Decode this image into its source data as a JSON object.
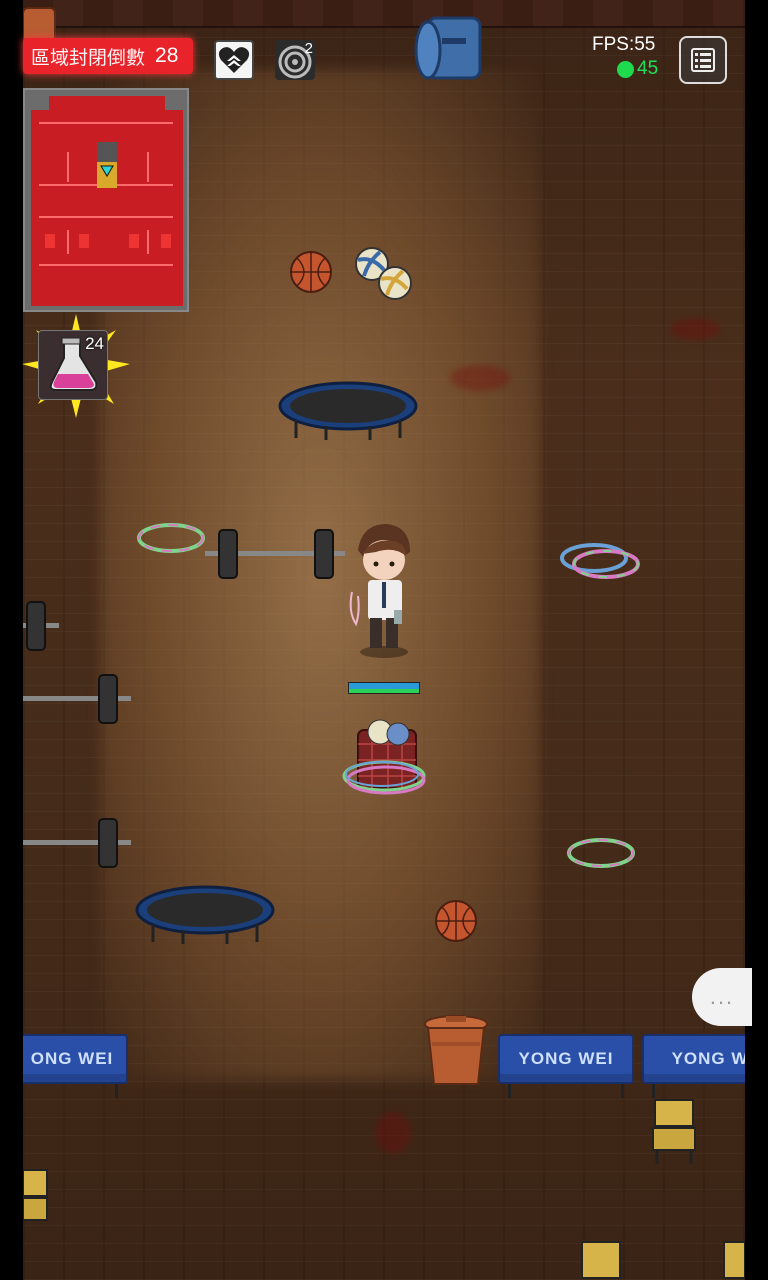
{
  "hud": {
    "countdown_label": "區域封閉倒數",
    "countdown_value": "28",
    "target_count": "2",
    "fps_text": "FPS:55",
    "ping_value": "45"
  },
  "inventory": {
    "item_name": "pink-potion-icon",
    "item_count": "24"
  },
  "chat": {
    "label": "..."
  },
  "scene": {
    "banner_text": "YONG WEI",
    "banner_partial_left": "ONG WEI",
    "banner_partial_right": "YONG W"
  },
  "player": {
    "hp_fraction": 1.0
  },
  "colors": {
    "alert_red": "#e8232a",
    "ping_green": "#1fd94f",
    "banner_blue": "#2a4fa8"
  }
}
